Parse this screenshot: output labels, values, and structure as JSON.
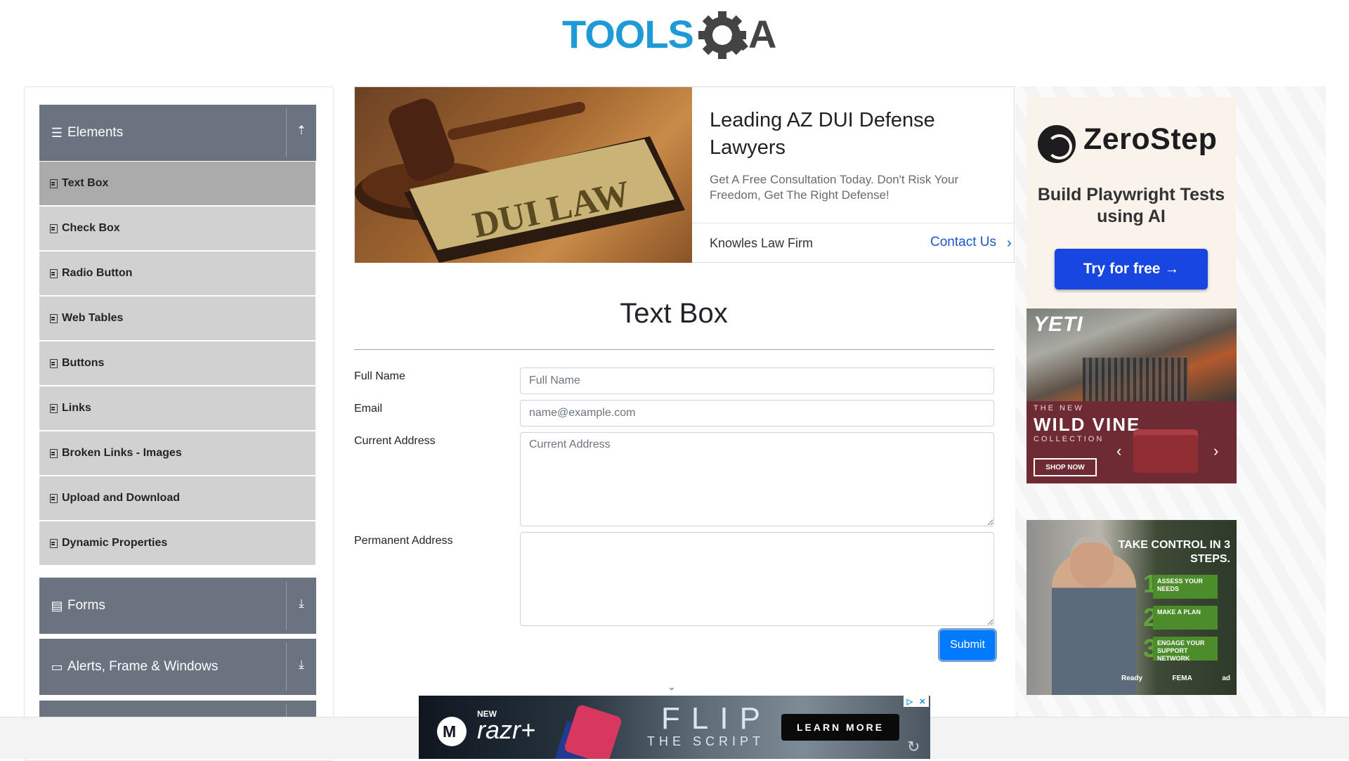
{
  "header": {
    "logo_text": "TOOLSQA"
  },
  "sidebar": {
    "groups": [
      {
        "label": "Elements",
        "icon": "hamburger-icon",
        "arrow": "collapse-up-icon"
      },
      {
        "label": "Forms",
        "icon": "document-icon",
        "arrow": "expand-down-icon"
      },
      {
        "label": "Alerts, Frame & Windows",
        "icon": "window-icon",
        "arrow": "expand-down-icon"
      }
    ],
    "items": [
      {
        "label": "Text Box",
        "active": true
      },
      {
        "label": "Check Box"
      },
      {
        "label": "Radio Button"
      },
      {
        "label": "Web Tables"
      },
      {
        "label": "Buttons"
      },
      {
        "label": "Links"
      },
      {
        "label": "Broken Links - Images"
      },
      {
        "label": "Upload and Download"
      },
      {
        "label": "Dynamic Properties"
      }
    ]
  },
  "main_ad": {
    "photo_text": "DUI LAW",
    "title": "Leading AZ DUI Defense Lawyers",
    "subtitle": "Get A Free Consultation Today. Don't Risk Your Freedom, Get The Right Defense!",
    "firm": "Knowles Law Firm",
    "cta": "Contact Us"
  },
  "page": {
    "title": "Text Box"
  },
  "form": {
    "full_name": {
      "label": "Full Name",
      "placeholder": "Full Name",
      "value": ""
    },
    "email": {
      "label": "Email",
      "placeholder": "name@example.com",
      "value": ""
    },
    "current_address": {
      "label": "Current Address",
      "placeholder": "Current Address",
      "value": ""
    },
    "permanent_address": {
      "label": "Permanent Address",
      "placeholder": "",
      "value": ""
    },
    "submit_label": "Submit"
  },
  "right_ads": {
    "zerostep": {
      "brand": "ZeroStep",
      "tagline": "Build Playwright Tests using AI",
      "button": "Try for free →"
    },
    "yeti": {
      "brand": "YETI",
      "new": "THE NEW",
      "title": "WILD VINE",
      "collection": "COLLECTION",
      "shop": "SHOP NOW"
    },
    "fema": {
      "title": "TAKE CONTROL IN 3 STEPS.",
      "steps": [
        "ASSESS YOUR NEEDS",
        "MAKE A PLAN",
        "ENGAGE YOUR SUPPORT NETWORK"
      ],
      "footer": [
        "Ready",
        "FEMA",
        "ad"
      ]
    }
  },
  "bottom_ad": {
    "new": "NEW",
    "product": "razr+",
    "headline": "FLIP",
    "subline": "THE SCRIPT",
    "cta": "LEARN MORE"
  },
  "colors": {
    "primary": "#007bff",
    "sidebar_header": "#6b7380",
    "sidebar_item": "#d1d1d1",
    "sidebar_active": "#ababab",
    "logo_blue": "#1e9bd7"
  }
}
